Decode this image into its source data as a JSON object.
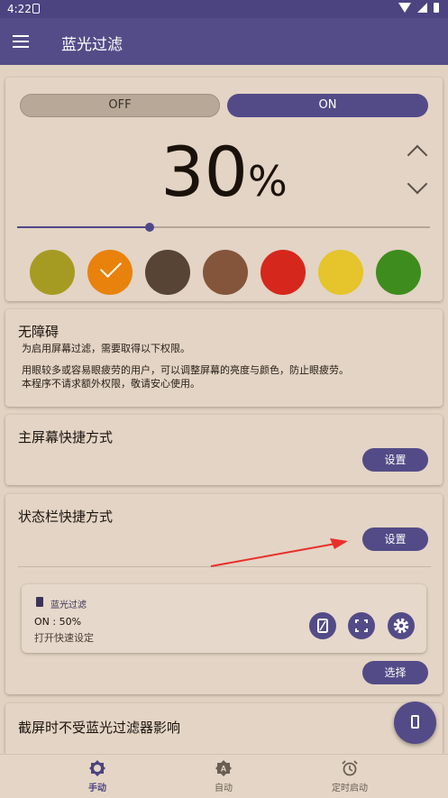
{
  "status_bar": {
    "time": "4:22"
  },
  "app_bar": {
    "title": "蓝光过滤"
  },
  "filter_card": {
    "toggle_off_label": "OFF",
    "toggle_on_label": "ON",
    "toggle_state": "ON",
    "intensity_value": "30",
    "intensity_unit": "%",
    "slider_level": 0.32,
    "colors": [
      "#a69b22",
      "#e8820c",
      "#574434",
      "#84553a",
      "#d6271d",
      "#e5c42c",
      "#3f8c1e"
    ],
    "selected_color_index": 1
  },
  "accessibility_card": {
    "title": "无障碍",
    "line1": "为启用屏幕过滤，需要取得以下权限。",
    "line2": "用眼较多或容易眼疲劳的用户，可以调整屏幕的亮度与颜色，防止眼疲劳。",
    "line3": "本程序不请求额外权限，敬请安心使用。"
  },
  "home_shortcut_card": {
    "title": "主屏幕快捷方式",
    "button_label": "设置"
  },
  "statusbar_shortcut_card": {
    "title": "状态栏快捷方式",
    "button_label": "设置",
    "notification": {
      "app_name": "蓝光过滤",
      "status": "ON : 50%",
      "subtitle": "打开快速设定"
    },
    "select_label": "选择"
  },
  "screenshot_card": {
    "title": "截屏时不受蓝光过滤器影响"
  },
  "bottom_nav": {
    "items": [
      "手动",
      "自动",
      "定时启动"
    ],
    "active_index": 0
  },
  "accent_color": "#544c88",
  "arrow_color": "#e8302a"
}
